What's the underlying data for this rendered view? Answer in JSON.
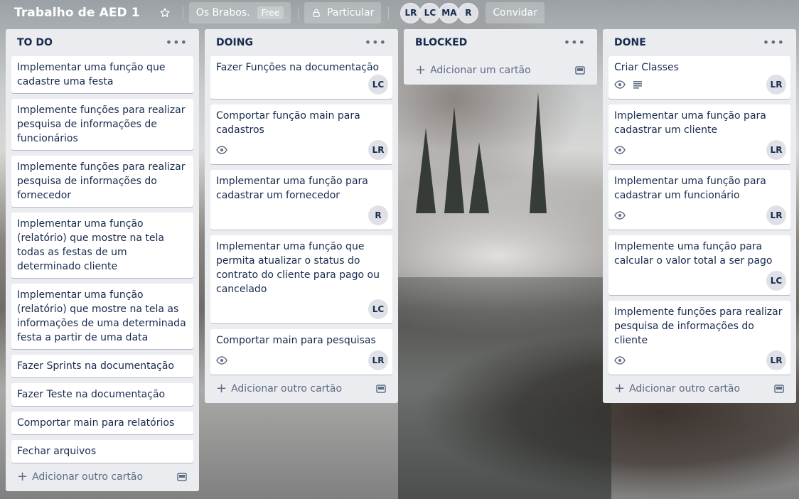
{
  "header": {
    "board_title": "Trabalho de AED 1",
    "team_name": "Os Brabos.",
    "team_badge": "Free",
    "visibility": "Particular",
    "members": [
      "LR",
      "LC",
      "MA",
      "R"
    ],
    "invite_label": "Convidar"
  },
  "lists": [
    {
      "title": "TO DO",
      "cards": [
        {
          "text": "Implementar uma função que cadastre uma festa"
        },
        {
          "text": "Implemente funções para realizar pesquisa de informações de funcionários"
        },
        {
          "text": "Implemente funções para realizar pesquisa de informações do fornecedor"
        },
        {
          "text": "Implementar uma função (relatório) que mostre na tela todas as festas de um determinado cliente"
        },
        {
          "text": "Implementar uma função (relatório) que mostre na tela as informações de uma determinada festa a partir de uma data"
        },
        {
          "text": "Fazer Sprints na documentação"
        },
        {
          "text": "Fazer Teste na documentação"
        },
        {
          "text": "Comportar main para relatórios"
        },
        {
          "text": "Fechar arquivos"
        }
      ],
      "add_label": "Adicionar outro cartão"
    },
    {
      "title": "DOING",
      "cards": [
        {
          "text": "Fazer Funções na documentação",
          "member": "LC"
        },
        {
          "text": "Comportar função main para cadastros",
          "member": "LR",
          "watch": true
        },
        {
          "text": "Implementar uma função para cadastrar um fornecedor",
          "member": "R"
        },
        {
          "text": "Implementar uma função que permita atualizar o status do contrato do cliente para pago ou cancelado",
          "member": "LC"
        },
        {
          "text": "Comportar main para pesquisas",
          "member": "LR",
          "watch": true
        }
      ],
      "add_label": "Adicionar outro cartão"
    },
    {
      "title": "BLOCKED",
      "cards": [],
      "add_label": "Adicionar um cartão"
    },
    {
      "title": "DONE",
      "cards": [
        {
          "text": "Criar Classes",
          "member": "LR",
          "watch": true,
          "description": true
        },
        {
          "text": "Implementar uma função para cadastrar um cliente",
          "member": "LR",
          "watch": true
        },
        {
          "text": "Implementar uma função para cadastrar um funcionário",
          "member": "LR",
          "watch": true
        },
        {
          "text": "Implemente uma função para calcular o valor total a ser pago",
          "member": "LC"
        },
        {
          "text": "Implemente funções para realizar pesquisa de informações do cliente",
          "member": "LR",
          "watch": true
        }
      ],
      "add_label": "Adicionar outro cartão"
    }
  ],
  "icons": {
    "star": "star-icon",
    "lock": "lock-icon",
    "menu": "more-horizontal-icon",
    "watch": "eye-icon",
    "description": "description-icon",
    "add": "plus-icon",
    "template": "card-template-icon"
  },
  "colors": {
    "list_bg": "#ebecf0",
    "card_bg": "#ffffff",
    "text": "#172b4d",
    "muted": "#5e6c84"
  }
}
